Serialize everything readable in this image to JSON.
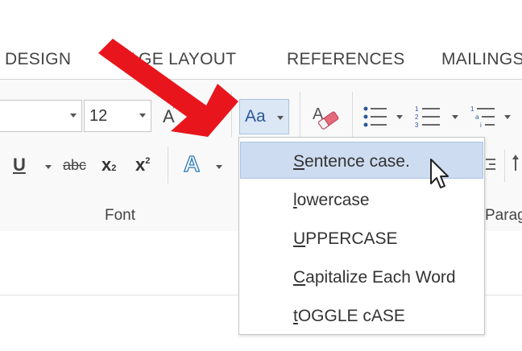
{
  "tabs": [
    {
      "label": "DESIGN"
    },
    {
      "label": "PAGE LAYOUT"
    },
    {
      "label": "REFERENCES"
    },
    {
      "label": "MAILINGS"
    }
  ],
  "font": {
    "size": "12",
    "group_label": "Font",
    "change_case_label": "Aa"
  },
  "paragraph": {
    "group_label_partial": "Paragr"
  },
  "change_case_menu": {
    "items": [
      {
        "mnemonic": "S",
        "rest": "entence case.",
        "highlighted": true
      },
      {
        "mnemonic": "l",
        "rest": "owercase",
        "highlighted": false
      },
      {
        "mnemonic": "U",
        "rest": "PPERCASE",
        "highlighted": false
      },
      {
        "mnemonic": "C",
        "rest": "apitalize Each Word",
        "highlighted": false
      },
      {
        "mnemonic": "t",
        "rest": "OGGLE cASE",
        "highlighted": false
      }
    ]
  },
  "icons": {
    "bullets": "bullets-icon",
    "numbering": "numbering-icon",
    "multilevel": "multilevel-list-icon",
    "clear_formatting": "clear-formatting-icon",
    "annotation": "red-arrow-icon",
    "pointer": "mouse-cursor-icon"
  },
  "colors": {
    "accent": "#2b5797",
    "highlight": "#cddcf0",
    "arrow": "#e8161c"
  }
}
